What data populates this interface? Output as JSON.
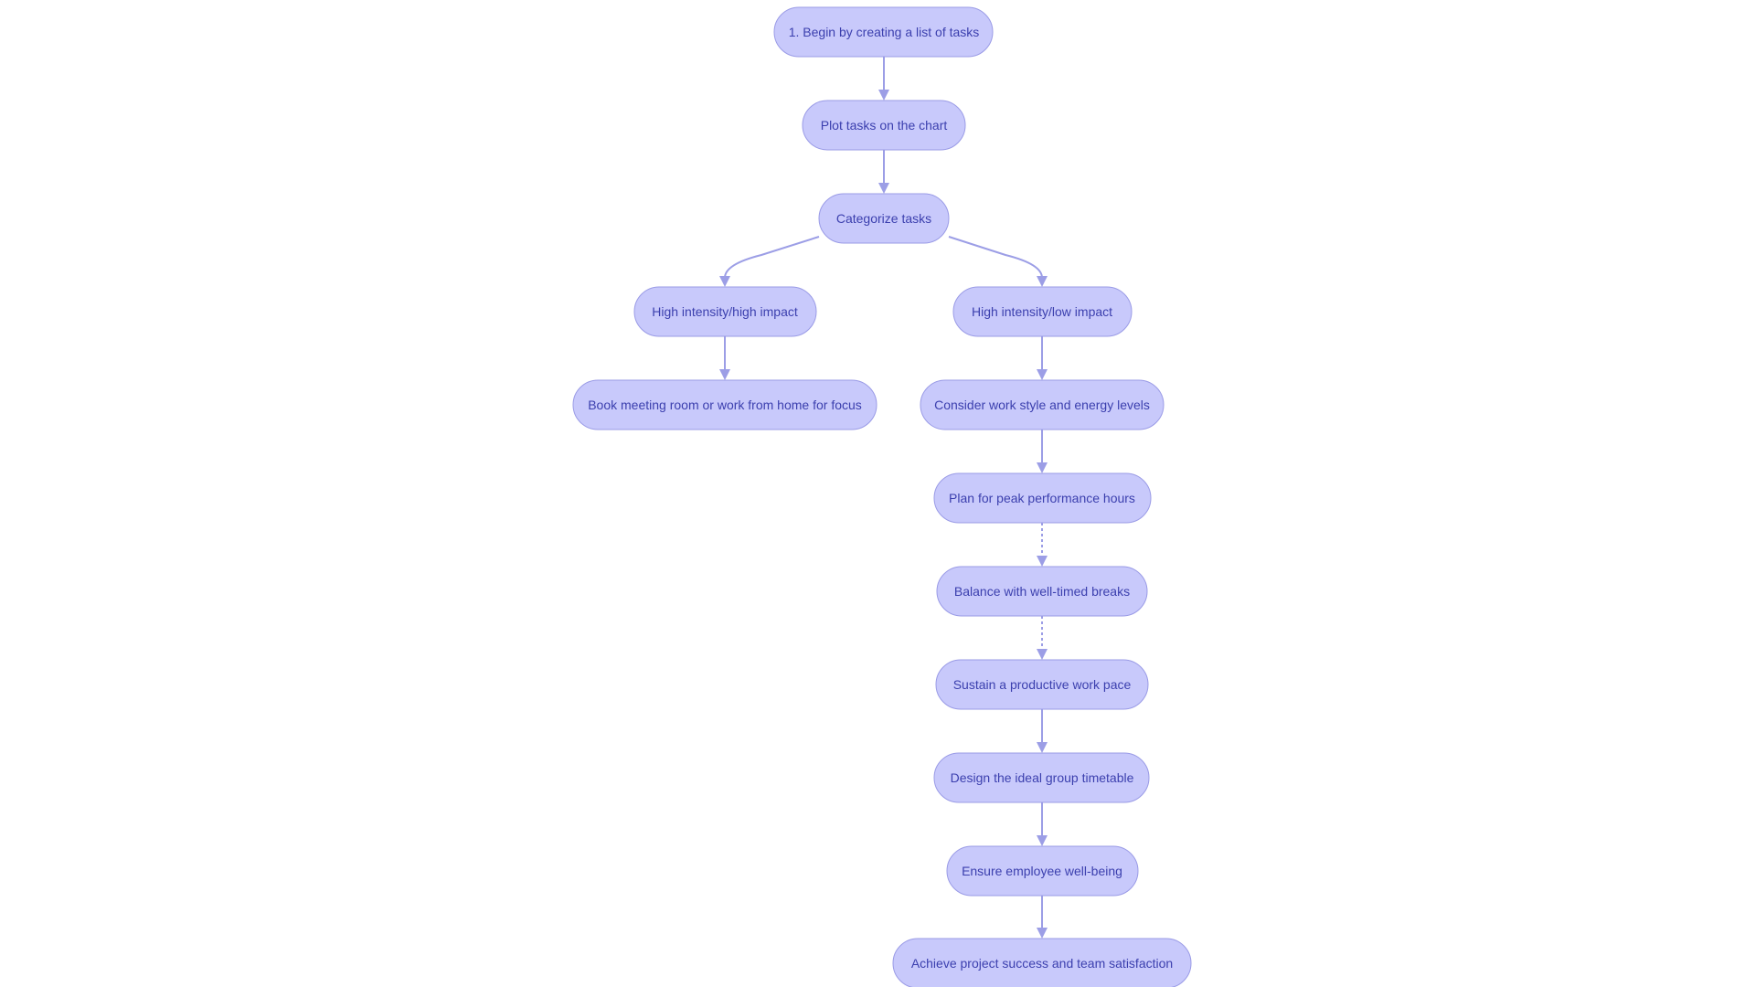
{
  "diagram": {
    "type": "flowchart",
    "colors": {
      "node_fill": "#c8c9fb",
      "node_stroke": "#9a9be6",
      "text": "#3b3fae",
      "edge": "#9c9ee6"
    },
    "nodes": [
      {
        "id": "begin",
        "label": "1. Begin by creating a list of tasks"
      },
      {
        "id": "plot",
        "label": "Plot tasks on the chart"
      },
      {
        "id": "categorize",
        "label": "Categorize tasks"
      },
      {
        "id": "hihi",
        "label": "High intensity/high impact"
      },
      {
        "id": "hili",
        "label": "High intensity/low impact"
      },
      {
        "id": "book",
        "label": "Book meeting room or work from home for focus"
      },
      {
        "id": "consider",
        "label": "Consider work style and energy levels"
      },
      {
        "id": "plan",
        "label": "Plan for peak performance hours"
      },
      {
        "id": "balance",
        "label": "Balance with well-timed breaks"
      },
      {
        "id": "sustain",
        "label": "Sustain a productive work pace"
      },
      {
        "id": "design",
        "label": "Design the ideal group timetable"
      },
      {
        "id": "ensure",
        "label": "Ensure employee well-being"
      },
      {
        "id": "achieve",
        "label": "Achieve project success and team satisfaction"
      }
    ],
    "edges": [
      {
        "from": "begin",
        "to": "plot",
        "style": "solid"
      },
      {
        "from": "plot",
        "to": "categorize",
        "style": "solid"
      },
      {
        "from": "categorize",
        "to": "hihi",
        "style": "solid"
      },
      {
        "from": "categorize",
        "to": "hili",
        "style": "solid"
      },
      {
        "from": "hihi",
        "to": "book",
        "style": "solid"
      },
      {
        "from": "hili",
        "to": "consider",
        "style": "solid"
      },
      {
        "from": "consider",
        "to": "plan",
        "style": "solid"
      },
      {
        "from": "plan",
        "to": "balance",
        "style": "dotted"
      },
      {
        "from": "balance",
        "to": "sustain",
        "style": "dotted"
      },
      {
        "from": "sustain",
        "to": "design",
        "style": "solid"
      },
      {
        "from": "design",
        "to": "ensure",
        "style": "solid"
      },
      {
        "from": "ensure",
        "to": "achieve",
        "style": "solid"
      }
    ]
  }
}
